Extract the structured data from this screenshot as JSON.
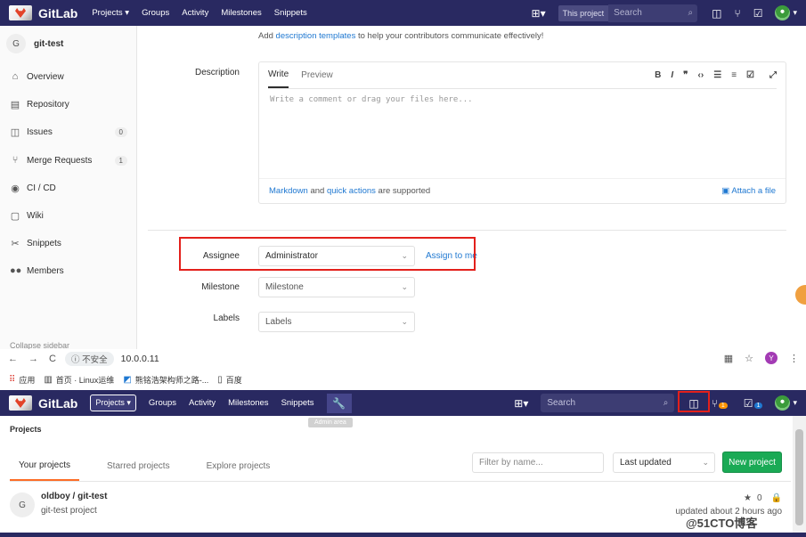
{
  "top": {
    "brand": "GitLab",
    "nav": [
      "Projects ▾",
      "Groups",
      "Activity",
      "Milestones",
      "Snippets"
    ],
    "search_scope": "This project",
    "search_placeholder": "Search",
    "project_initial": "G",
    "project_name": "git-test",
    "sidebar": [
      {
        "label": "Overview",
        "icon": "home-icon"
      },
      {
        "label": "Repository",
        "icon": "book-icon"
      },
      {
        "label": "Issues",
        "icon": "issues-icon",
        "count": "0"
      },
      {
        "label": "Merge Requests",
        "icon": "merge-request-icon",
        "count": "1"
      },
      {
        "label": "CI / CD",
        "icon": "rocket-icon"
      },
      {
        "label": "Wiki",
        "icon": "wiki-icon"
      },
      {
        "label": "Snippets",
        "icon": "scissors-icon"
      },
      {
        "label": "Members",
        "icon": "users-icon"
      }
    ],
    "collapse_label": "Collapse sidebar",
    "help_prefix": "Add ",
    "help_link": "description templates",
    "help_suffix": " to help your contributors communicate effectively!",
    "description_label": "Description",
    "tab_write": "Write",
    "tab_preview": "Preview",
    "editor_placeholder": "Write a comment or drag your files here...",
    "footer_md": "Markdown",
    "footer_and": " and ",
    "footer_qa": "quick actions",
    "footer_supported": " are supported",
    "attach": "Attach a file",
    "assignee_label": "Assignee",
    "assignee_value": "Administrator",
    "assign_me": "Assign to me",
    "milestone_label": "Milestone",
    "milestone_value": "Milestone",
    "labels_label": "Labels",
    "labels_value": "Labels"
  },
  "chrome": {
    "insecure": "不安全",
    "url": "10.0.0.11",
    "profile_initial": "Y",
    "bookmarks": [
      "应用",
      "首页 · Linux运维",
      "熊铭浩架构师之路-...",
      "百度"
    ]
  },
  "bottom": {
    "brand": "GitLab",
    "projects_btn": "Projects",
    "nav": [
      "Groups",
      "Activity",
      "Milestones",
      "Snippets"
    ],
    "tooltip": "Admin area",
    "search_placeholder": "Search",
    "mr_badge": "1",
    "todo_badge": "1",
    "crumb": "Projects",
    "tabs": [
      "Your projects",
      "Starred projects",
      "Explore projects"
    ],
    "filter_placeholder": "Filter by name...",
    "sort_value": "Last updated",
    "new_project": "New project",
    "row_initial": "G",
    "row_title": "oldboy / git-test",
    "row_desc": "git-test project",
    "row_stars": "0",
    "row_updated": "updated about 2 hours ago"
  },
  "watermark": "@51CTO博客",
  "colors": {
    "navbar": "#292961",
    "highlight": "#e3201b",
    "primary": "#1aaa55",
    "link": "#1f78d1"
  }
}
